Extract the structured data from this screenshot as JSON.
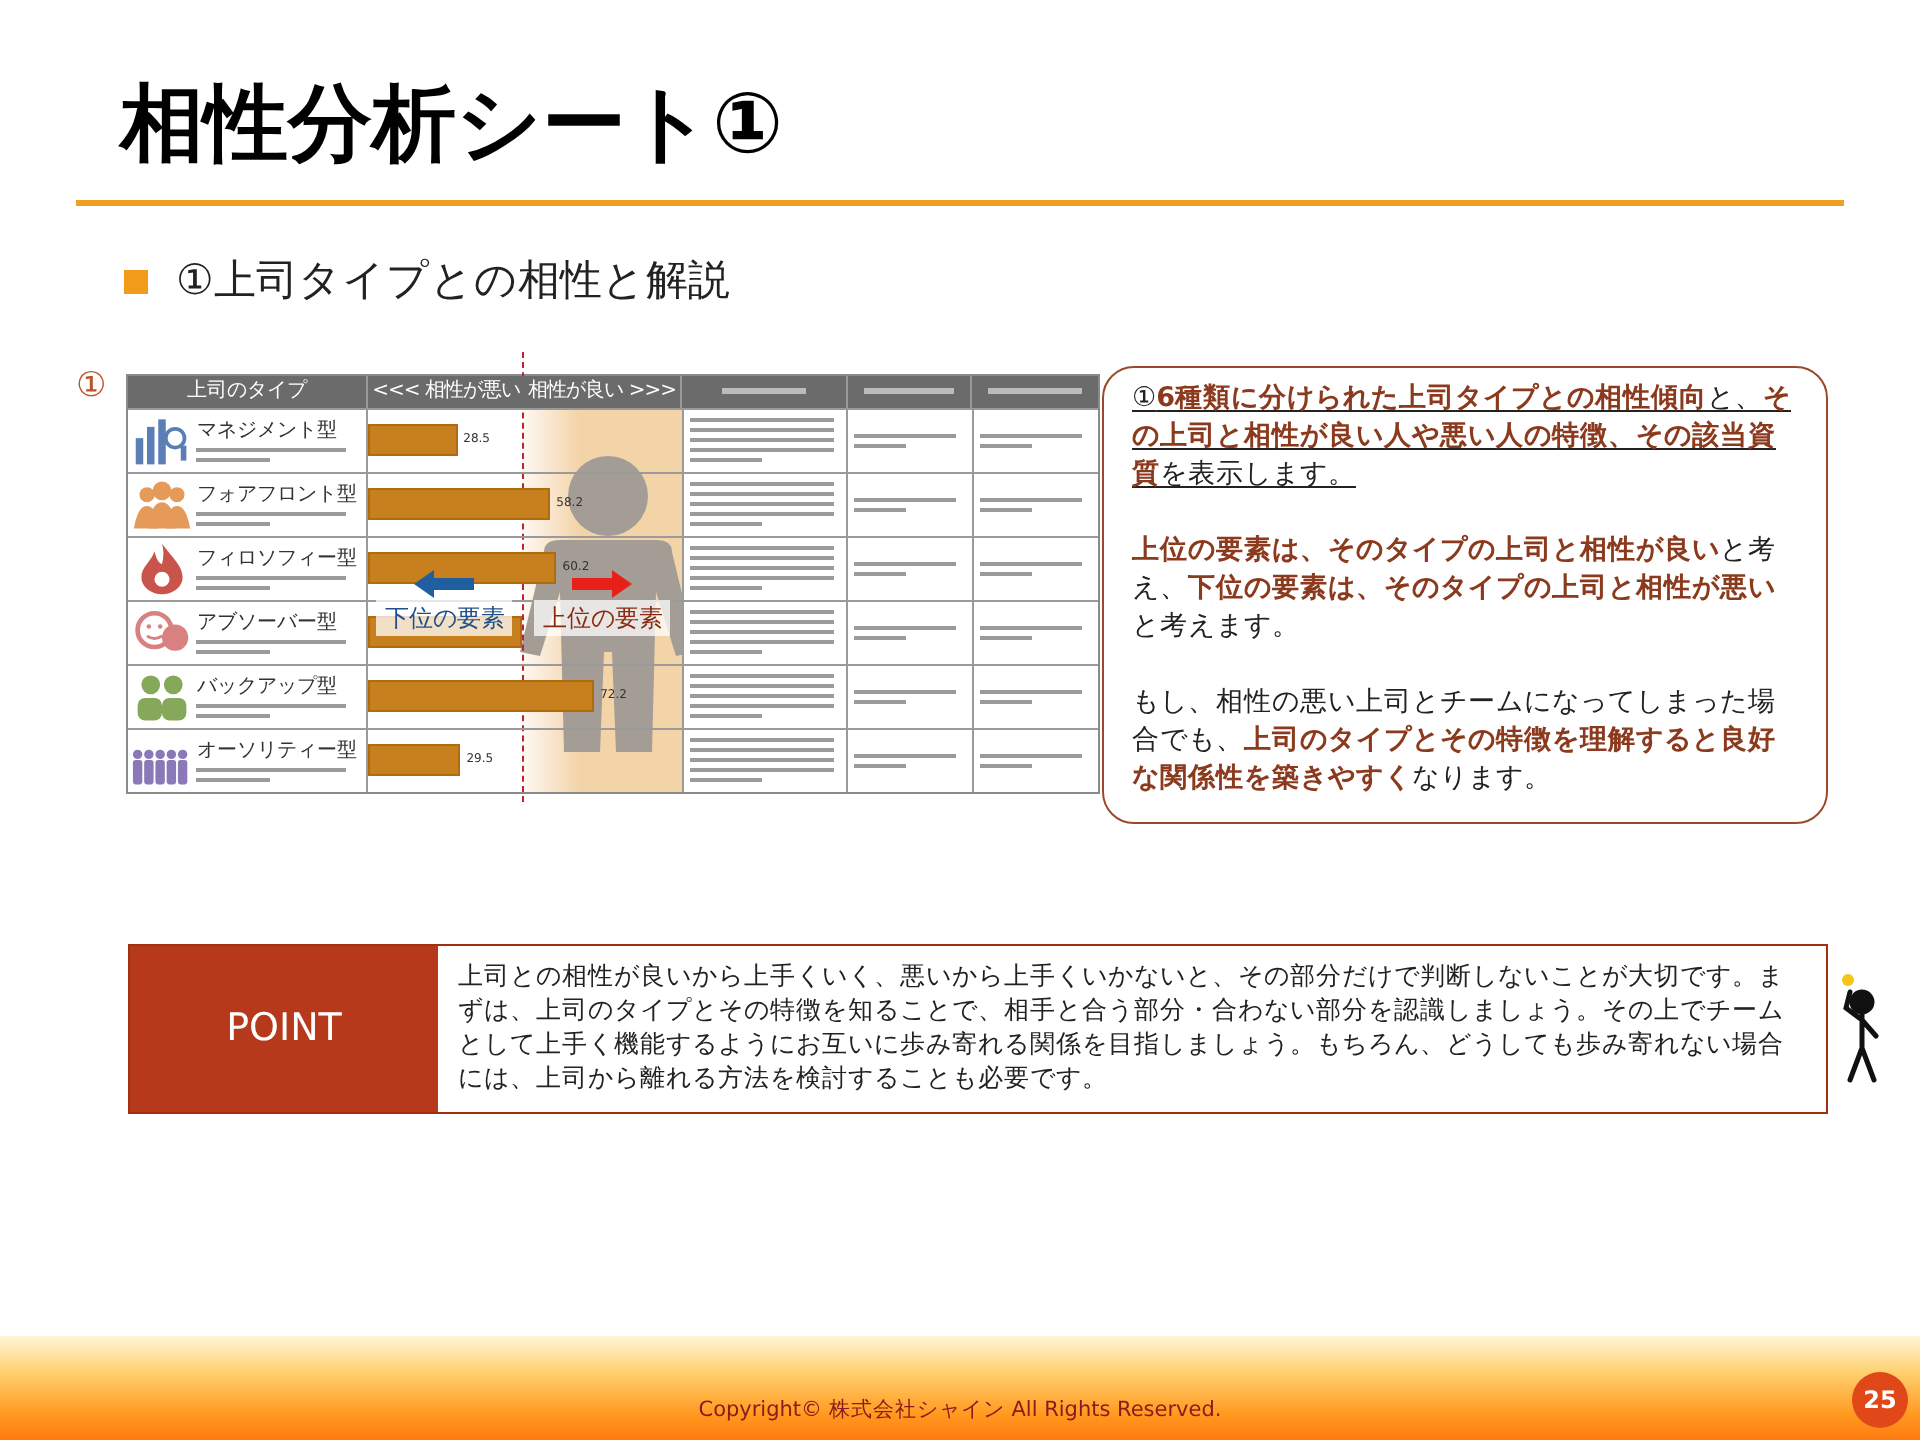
{
  "title": "相性分析シート①",
  "section": {
    "heading": "①上司タイプとの相性と解説"
  },
  "figure": {
    "marker": "①",
    "headers": [
      "上司のタイプ",
      "<<< 相性が悪い",
      "相性が良い >>>"
    ],
    "rows": [
      {
        "name": "マネジメント型",
        "kind": "bars",
        "color": "#5b7fb5",
        "level": 0.285,
        "value": "28.5"
      },
      {
        "name": "フォアフロント型",
        "kind": "people",
        "color": "#e59a5a",
        "level": 0.582,
        "value": "58.2"
      },
      {
        "name": "フィロソフィー型",
        "kind": "flame",
        "color": "#c8544c",
        "level": 0.602,
        "value": "60.2"
      },
      {
        "name": "アブソーバー型",
        "kind": "faces",
        "color": "#d98080",
        "level": 0.49
      },
      {
        "name": "バックアップ型",
        "kind": "duo",
        "color": "#86a85a",
        "level": 0.722,
        "value": "72.2"
      },
      {
        "name": "オーソリティー型",
        "kind": "crowd",
        "color": "#8a78b8",
        "level": 0.295,
        "value": "29.5"
      }
    ],
    "lower_label": "下位の要素",
    "upper_label": "上位の要素"
  },
  "callout": [
    "①**6種類に分けられた上司タイプとの相性傾向**と、**その上司と相性が良い人や悪い人の特徴、その該当資質**を表示します。",
    "**上位の要素は、そのタイプの上司と相性が良い**と考え、**下位の要素は、そのタイプの上司と相性が悪い**と考えます。",
    "もし、相性の悪い上司とチームになってしまった場合でも、**上司のタイプとその特徴を理解すると良好な関係性を築きやすく**なります。"
  ],
  "point": {
    "label": "POINT",
    "text": "上司との相性が良いから上手くいく、悪いから上手くいかないと、その部分だけで判断しないことが大切です。まずは、上司のタイプとその特徴を知ることで、相手と合う部分・合わない部分を認識しましょう。その上でチームとして上手く機能するようにお互いに歩み寄れる関係を目指しましょう。もちろん、どうしても歩み寄れない場合には、上司から離れる方法を検討することも必要です。"
  },
  "footer": {
    "copyright": "Copyright© 株式会社シャイン All Rights Reserved.",
    "page": "25"
  }
}
